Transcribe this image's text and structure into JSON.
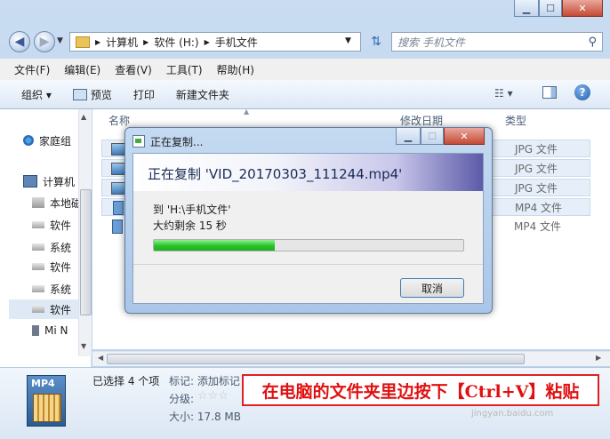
{
  "address": {
    "segments": [
      "计算机",
      "软件 (H:)",
      "手机文件"
    ]
  },
  "search": {
    "placeholder": "搜索 手机文件"
  },
  "menu": [
    "文件(F)",
    "编辑(E)",
    "查看(V)",
    "工具(T)",
    "帮助(H)"
  ],
  "toolbar": {
    "organize": "组织 ▾",
    "preview": "预览",
    "print": "打印",
    "new_folder": "新建文件夹"
  },
  "nav": {
    "items": [
      {
        "label": "家庭组",
        "icon": "homegroup-icon"
      },
      {
        "label": "计算机",
        "icon": "computer-icon"
      },
      {
        "label": "本地磁",
        "icon": "local-disk-icon"
      },
      {
        "label": "软件",
        "icon": "drive-icon"
      },
      {
        "label": "系统",
        "icon": "drive-icon"
      },
      {
        "label": "软件",
        "icon": "drive-icon"
      },
      {
        "label": "系统",
        "icon": "drive-icon"
      },
      {
        "label": "软件",
        "icon": "drive-icon"
      },
      {
        "label": "Mi N",
        "icon": "phone-icon"
      }
    ]
  },
  "columns": {
    "name": "名称",
    "date": "修改日期",
    "type": "类型"
  },
  "files": [
    {
      "type": "JPG 文件"
    },
    {
      "type": "JPG 文件"
    },
    {
      "type": "JPG 文件"
    },
    {
      "type": "MP4 文件"
    },
    {
      "type": "MP4 文件"
    }
  ],
  "dialog": {
    "title": "正在复制...",
    "heading": "正在复制 'VID_20170303_111244.mp4'",
    "to": "到 'H:\\手机文件'",
    "remaining": "大约剩余 15 秒",
    "progress": 0.39,
    "cancel": "取消"
  },
  "details": {
    "thumb_label": "MP4",
    "selected": "已选择 4 个项",
    "tags": "标记: 添加标记",
    "rating_label": "分级:",
    "size": "大小: 17.8 MB"
  },
  "note": "在电脑的文件夹里边按下【Ctrl+V】粘贴",
  "watermark": "jingyan.baidu.com",
  "colors": {
    "accent": "#3c7fb1",
    "progress": "#28c428",
    "note": "#e01010"
  }
}
